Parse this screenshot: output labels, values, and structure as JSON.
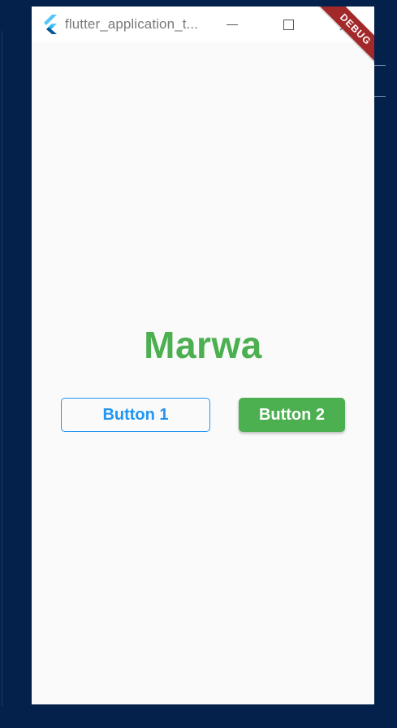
{
  "window": {
    "title": "flutter_application_t...",
    "app_icon": "flutter-logo-icon",
    "controls": {
      "minimize_icon": "minimize-icon",
      "maximize_icon": "maximize-icon",
      "close_icon": "close-icon"
    }
  },
  "debug_banner": {
    "label": "DEBUG",
    "color": "#a3282a"
  },
  "main": {
    "headline": "Marwa",
    "headline_color": "#4caf50",
    "button1": {
      "label": "Button 1",
      "color": "#2196f3"
    },
    "button2": {
      "label": "Button 2",
      "color": "#4caf50"
    }
  }
}
